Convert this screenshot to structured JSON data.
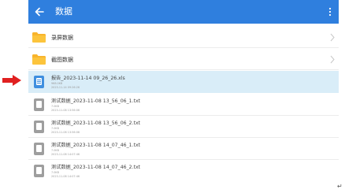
{
  "header": {
    "title": "数据"
  },
  "folders": [
    {
      "name": "录屏数据"
    },
    {
      "name": "截图数据"
    }
  ],
  "files": [
    {
      "name": "报告_2023-11-14 09_26_26.xls",
      "size": "968.0KB",
      "date": "2023-11-14 09:26:26",
      "type": "xls",
      "selected": true
    },
    {
      "name": "测试数据_2023-11-08 13_56_06_1.txt",
      "size": "7.0KB",
      "date": "2023-11-08 13:56:06",
      "type": "txt",
      "selected": false
    },
    {
      "name": "测试数据_2023-11-08 13_56_06_2.txt",
      "size": "7.0KB",
      "date": "2023-11-08 13:56:06",
      "type": "txt",
      "selected": false
    },
    {
      "name": "测试数据_2023-11-08 14_07_46_1.txt",
      "size": "7.0KB",
      "date": "2023-11-08 14:07:46",
      "type": "txt",
      "selected": false
    },
    {
      "name": "测试数据_2023-11-08 14_07_46_2.txt",
      "size": "7.0KB",
      "date": "2023-11-08 14:07:46",
      "type": "txt",
      "selected": false
    }
  ],
  "colors": {
    "appbar": "#2f7fde",
    "selected_row": "#d9edf8",
    "folder": "#f8b42c",
    "pointer_arrow": "#e02020"
  },
  "icons": {
    "back": "arrow-left-icon",
    "more": "more-vert-icon",
    "folder": "folder-icon",
    "file": "file-icon",
    "chevron": "chevron-right-icon",
    "pointer": "red-arrow-icon"
  }
}
